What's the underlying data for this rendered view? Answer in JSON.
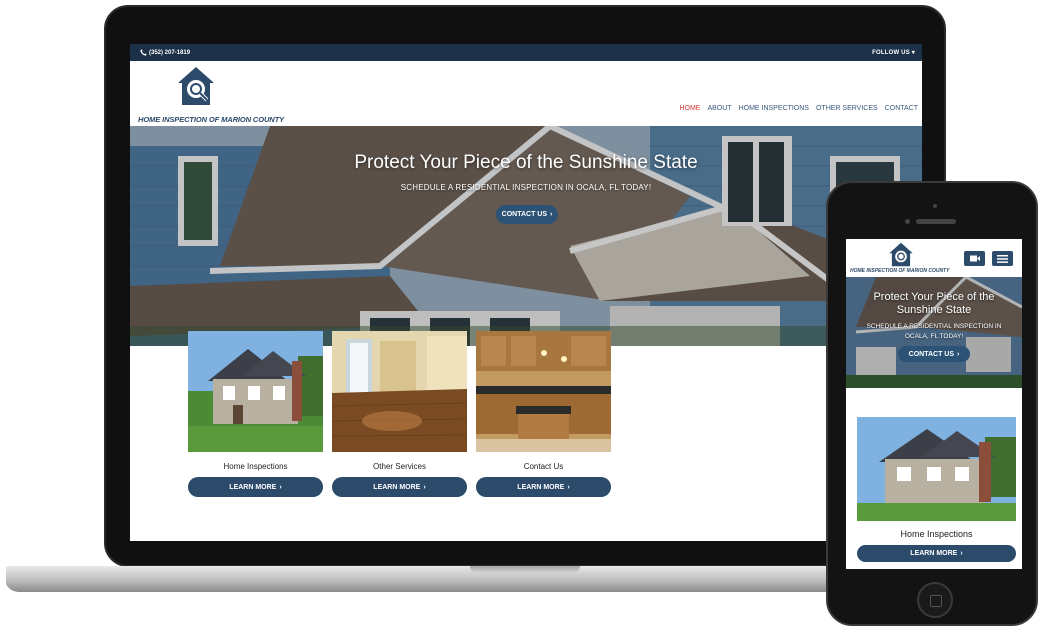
{
  "site": {
    "phone": "(352) 207-1819",
    "follow_us": "FOLLOW US",
    "logo_name": "HOME INSPECTION OF MARION COUNTY",
    "nav": [
      "HOME",
      "ABOUT",
      "HOME INSPECTIONS",
      "OTHER SERVICES",
      "CONTACT"
    ],
    "hero_title": "Protect Your Piece of the Sunshine State",
    "hero_subtitle": "SCHEDULE A RESIDENTIAL INSPECTION IN OCALA, FL TODAY!",
    "hero_cta": "CONTACT US",
    "cards": [
      {
        "label": "Home Inspections",
        "button": "LEARN MORE"
      },
      {
        "label": "Other Services",
        "button": "LEARN MORE"
      },
      {
        "label": "Contact Us",
        "button": "LEARN MORE"
      }
    ]
  },
  "mobile": {
    "logo_name": "HOME INSPECTION OF MARION COUNTY",
    "hero_title": "Protect Your Piece of the Sunshine State",
    "hero_subtitle": "SCHEDULE A RESIDENTIAL INSPECTION IN OCALA, FL TODAY!",
    "hero_cta": "CONTACT US",
    "card_label": "Home Inspections",
    "card_button": "LEARN MORE"
  },
  "icons": {
    "phone": "phone-icon",
    "chevron": "chevron-right-icon",
    "logo": "house-magnifier-logo",
    "video": "video-icon",
    "menu": "menu-icon"
  },
  "colors": {
    "brand_dark": "#1c3147",
    "brand": "#2c4a6a",
    "nav_active": "#d03a3a"
  }
}
